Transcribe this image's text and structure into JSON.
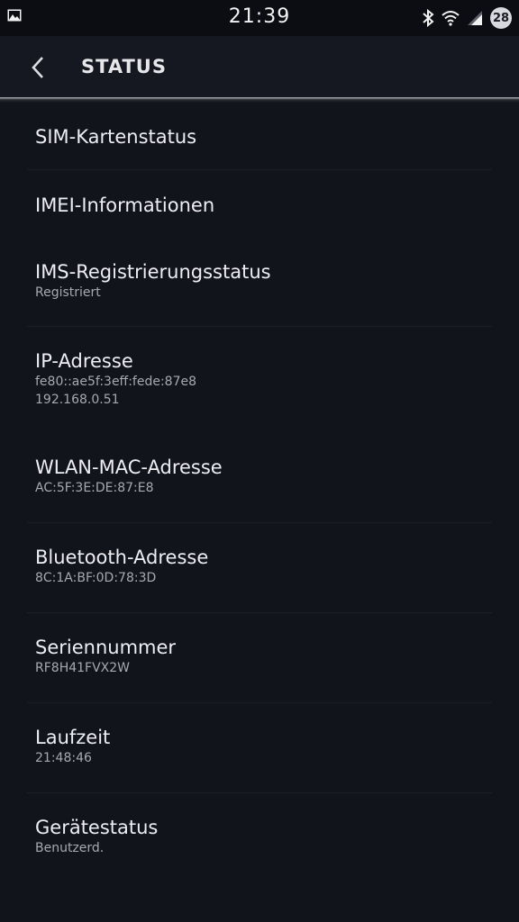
{
  "status_bar": {
    "time": "21:39",
    "battery": "28",
    "icons": [
      "gallery-icon",
      "bluetooth-icon",
      "wifi-icon",
      "signal-icon",
      "battery-icon"
    ]
  },
  "app_bar": {
    "title": "STATUS"
  },
  "items": [
    {
      "label": "SIM-Kartenstatus"
    },
    {
      "label": "IMEI-Informationen"
    },
    {
      "label": "IMS-Registrierungsstatus",
      "sub": "Registriert"
    },
    {
      "label": "IP-Adresse",
      "sub": "fe80::ae5f:3eff:fede:87e8",
      "sub2": "192.168.0.51"
    },
    {
      "label": "WLAN-MAC-Adresse",
      "sub": "AC:5F:3E:DE:87:E8"
    },
    {
      "label": "Bluetooth-Adresse",
      "sub": "8C:1A:BF:0D:78:3D"
    },
    {
      "label": "Seriennummer",
      "sub": "RF8H41FVX2W"
    },
    {
      "label": "Laufzeit",
      "sub": "21:48:46"
    },
    {
      "label": "Gerätestatus",
      "sub": "Benutzerd."
    }
  ],
  "colors": {
    "background": "#12141c",
    "status_bar": "#0c0d12",
    "app_bar": "#161821",
    "primary_text": "#eeeef2",
    "secondary_text": "#a8a9b0"
  }
}
